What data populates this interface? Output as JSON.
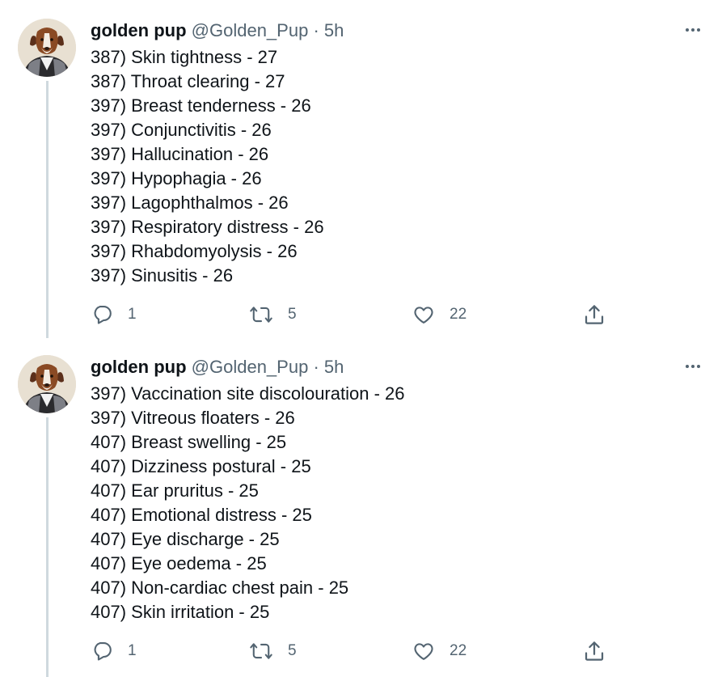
{
  "tweets": [
    {
      "display_name": "golden pup",
      "handle": "@Golden_Pup",
      "separator": "·",
      "time": "5h",
      "lines": [
        "387) Skin tightness - 27",
        "387) Throat clearing - 27",
        "397) Breast tenderness - 26",
        "397) Conjunctivitis - 26",
        "397) Hallucination - 26",
        "397) Hypophagia - 26",
        "397) Lagophthalmos - 26",
        "397) Respiratory distress - 26",
        "397) Rhabdomyolysis - 26",
        "397) Sinusitis - 26"
      ],
      "replies": "1",
      "retweets": "5",
      "likes": "22"
    },
    {
      "display_name": "golden pup",
      "handle": "@Golden_Pup",
      "separator": "·",
      "time": "5h",
      "lines": [
        "397) Vaccination site discolouration - 26",
        "397) Vitreous floaters - 26",
        "407) Breast swelling - 25",
        "407) Dizziness postural - 25",
        "407) Ear pruritus - 25",
        "407) Emotional distress - 25",
        "407) Eye discharge - 25",
        "407) Eye oedema - 25",
        "407) Non-cardiac chest pain - 25",
        "407) Skin irritation - 25"
      ],
      "replies": "1",
      "retweets": "5",
      "likes": "22"
    }
  ],
  "icons": {
    "reply": "reply-icon",
    "retweet": "retweet-icon",
    "like": "like-icon",
    "share": "share-icon",
    "more": "more-icon"
  },
  "colors": {
    "text": "#0f1419",
    "secondary": "#536471",
    "thread_line": "#cfd9de"
  }
}
